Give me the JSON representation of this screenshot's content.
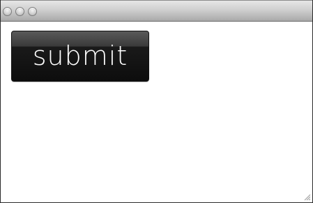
{
  "window": {
    "controls": {
      "close_icon": "close-icon",
      "minimize_icon": "minimize-icon",
      "zoom_icon": "zoom-icon"
    }
  },
  "form": {
    "submit_label": "submit"
  },
  "resize_grip_icon": "resize-grip-icon",
  "colors": {
    "button_background": "#1a1a1a",
    "button_text": "#ffffff",
    "titlebar": "#c8c8c8"
  }
}
